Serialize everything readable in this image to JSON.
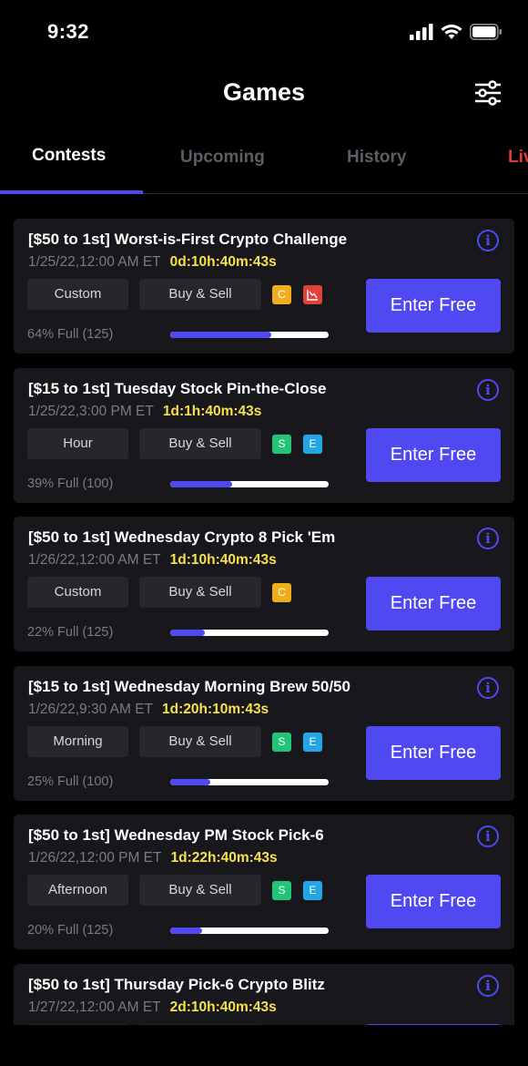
{
  "status": {
    "time": "9:32"
  },
  "header": {
    "title": "Games"
  },
  "tabs": [
    {
      "label": "Contests"
    },
    {
      "label": "Upcoming"
    },
    {
      "label": "History"
    },
    {
      "label": "Live"
    }
  ],
  "colors": {
    "accent": "#5048f0",
    "countdown": "#f6e14a",
    "live": "#e53935"
  },
  "contests": [
    {
      "title": "[$50 to 1st] Worst-is-First Crypto Challenge",
      "date": "1/25/22,12:00 AM ET",
      "countdown": "0d:10h:40m:43s",
      "mode": "Custom",
      "type": "Buy & Sell",
      "badges": [
        "C",
        "chart-down-icon"
      ],
      "fill_text": "64% Full (125)",
      "fill": 0.64,
      "button": "Enter Free"
    },
    {
      "title": "[$15 to 1st] Tuesday Stock Pin-the-Close",
      "date": "1/25/22,3:00 PM ET",
      "countdown": "1d:1h:40m:43s",
      "mode": "Hour",
      "type": "Buy & Sell",
      "badges": [
        "S",
        "E"
      ],
      "fill_text": "39% Full (100)",
      "fill": 0.39,
      "button": "Enter Free"
    },
    {
      "title": "[$50 to 1st] Wednesday Crypto 8 Pick 'Em",
      "date": "1/26/22,12:00 AM ET",
      "countdown": "1d:10h:40m:43s",
      "mode": "Custom",
      "type": "Buy & Sell",
      "badges": [
        "C"
      ],
      "fill_text": "22% Full (125)",
      "fill": 0.22,
      "button": "Enter Free"
    },
    {
      "title": "[$15 to 1st] Wednesday Morning Brew 50/50",
      "date": "1/26/22,9:30 AM ET",
      "countdown": "1d:20h:10m:43s",
      "mode": "Morning",
      "type": "Buy & Sell",
      "badges": [
        "S",
        "E"
      ],
      "fill_text": "25% Full (100)",
      "fill": 0.25,
      "button": "Enter Free"
    },
    {
      "title": "[$50 to 1st] Wednesday PM Stock Pick-6",
      "date": "1/26/22,12:00 PM ET",
      "countdown": "1d:22h:40m:43s",
      "mode": "Afternoon",
      "type": "Buy & Sell",
      "badges": [
        "S",
        "E"
      ],
      "fill_text": "20% Full (125)",
      "fill": 0.2,
      "button": "Enter Free"
    },
    {
      "title": "[$50 to 1st] Thursday Pick-6 Crypto Blitz",
      "date": "1/27/22,12:00 AM ET",
      "countdown": "2d:10h:40m:43s",
      "mode": "",
      "type": "",
      "badges": [],
      "fill_text": "",
      "fill": 0,
      "button": ""
    }
  ]
}
